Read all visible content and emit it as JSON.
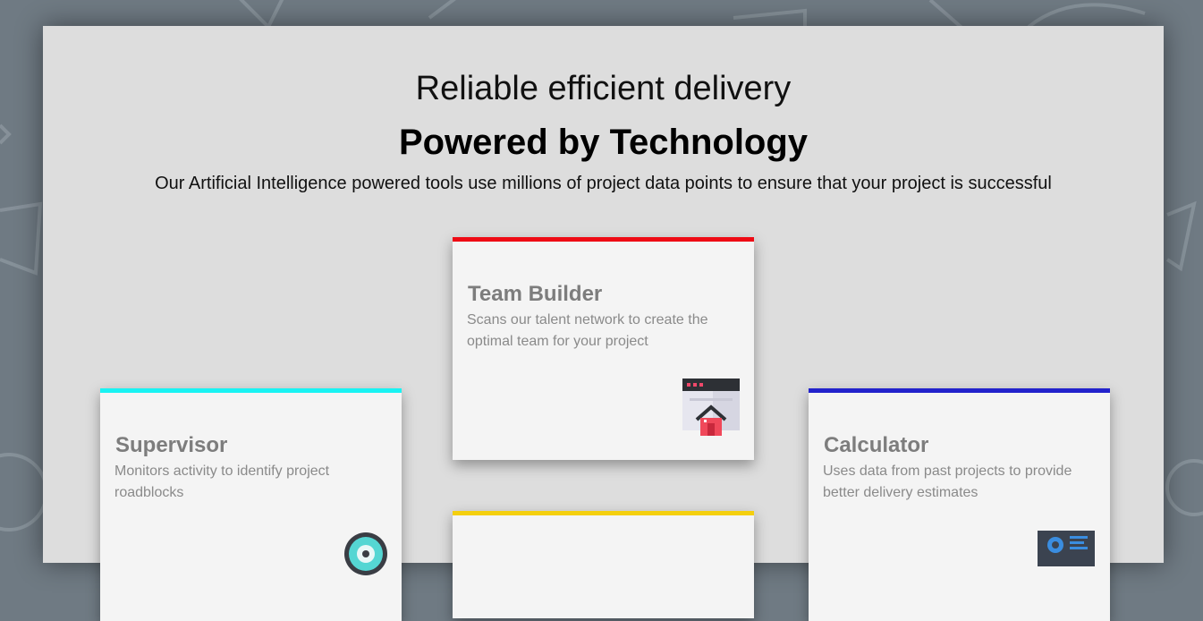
{
  "hero": {
    "title": "Reliable efficient delivery",
    "subtitle": "Powered by Technology",
    "description": "Our Artificial Intelligence powered tools use millions of project data points to ensure that your project is successful"
  },
  "cards": [
    {
      "title": "Team Builder",
      "description": "Scans our talent network to create the optimal team for your project",
      "accent": "#ee0a14",
      "icon": "browser-house-icon"
    },
    {
      "title": "Supervisor",
      "description": "Monitors activity to identify project roadblocks",
      "accent": "#19f3f3",
      "icon": "monitor-gauge-icon"
    },
    {
      "title": "Calculator",
      "description": "Uses data from past projects to provide better delivery estimates",
      "accent": "#2222cc",
      "icon": "calculator-icon"
    },
    {
      "title": "",
      "description": "",
      "accent": "#f4cf0e",
      "icon": ""
    }
  ],
  "colors": {
    "page_background": "#6f7a83",
    "panel_background": "#dddddd",
    "card_background": "#f4f4f4"
  }
}
